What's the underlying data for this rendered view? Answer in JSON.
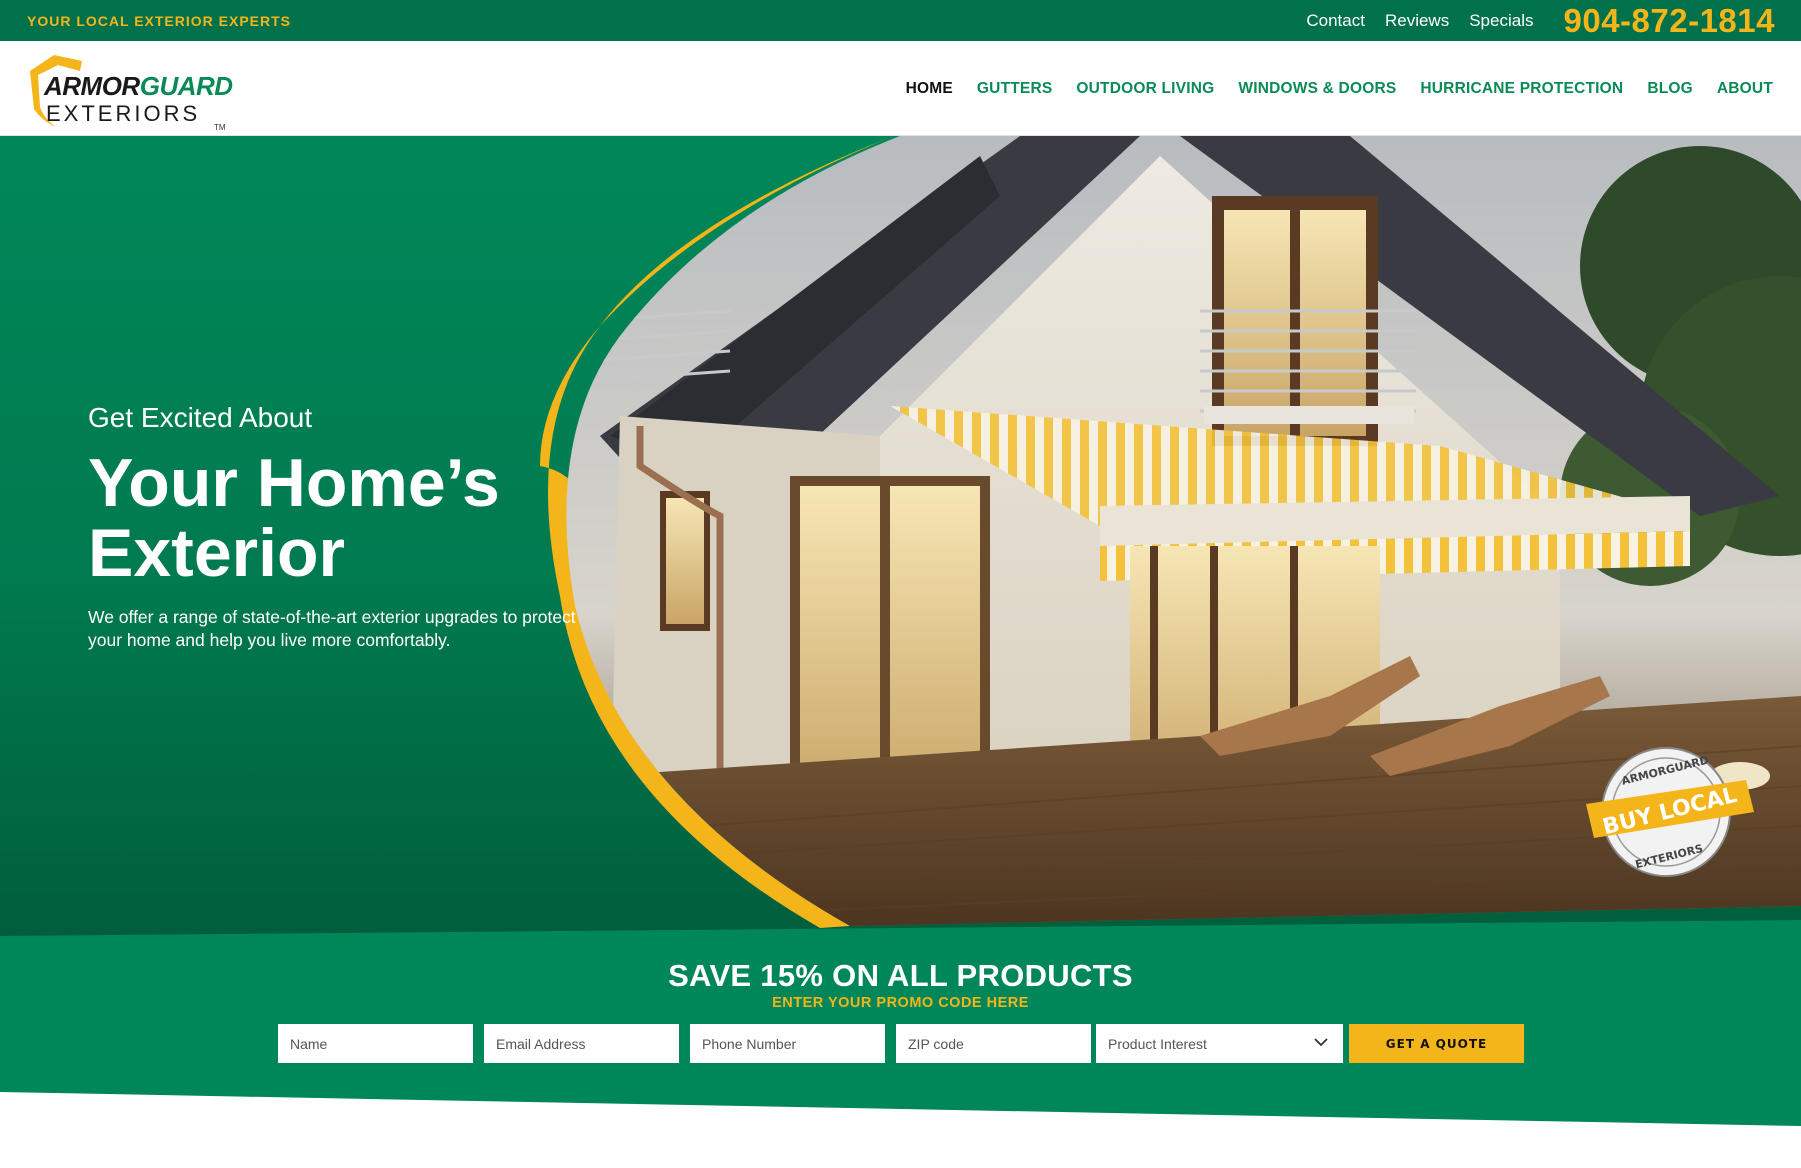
{
  "topbar": {
    "tagline": "YOUR LOCAL EXTERIOR EXPERTS",
    "links": [
      "Contact",
      "Reviews",
      "Specials"
    ],
    "phone": "904-872-1814"
  },
  "logo": {
    "word1": "ARMOR",
    "word2": "GUARD",
    "word3": "EXTERIORS",
    "tm": "TM"
  },
  "nav": {
    "items": [
      {
        "label": "HOME",
        "active": true
      },
      {
        "label": "GUTTERS"
      },
      {
        "label": "OUTDOOR LIVING"
      },
      {
        "label": "WINDOWS & DOORS"
      },
      {
        "label": "HURRICANE PROTECTION"
      },
      {
        "label": "BLOG"
      },
      {
        "label": "ABOUT"
      }
    ]
  },
  "hero": {
    "eyebrow": "Get Excited About",
    "headline_line1": "Your Home’s",
    "headline_line2": "Exterior",
    "subtext": "We offer a range of state-of-the-art exterior upgrades to protect your home and help you live more comfortably.",
    "badge": {
      "top_text": "ARMORGUARD",
      "ribbon_text": "BUY LOCAL",
      "bottom_text": "EXTERIORS"
    }
  },
  "promo": {
    "title": "SAVE 15% ON ALL PRODUCTS",
    "subtitle": "ENTER YOUR PROMO CODE HERE",
    "placeholders": {
      "name": "Name",
      "email": "Email Address",
      "phone": "Phone Number",
      "zip": "ZIP code"
    },
    "select_value": "Product Interest",
    "button": "GET A QUOTE"
  },
  "colors": {
    "brand_green": "#00714a",
    "hero_green": "#008759",
    "accent_yellow": "#f4b51b"
  }
}
